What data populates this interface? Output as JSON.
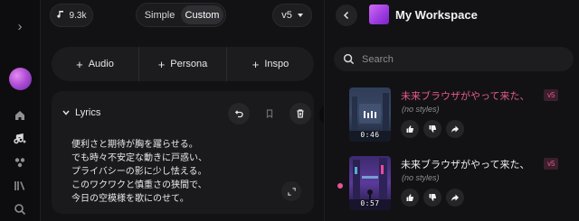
{
  "rail": {
    "icons": [
      "chevron-right-icon",
      "home-icon",
      "create-music-icon",
      "explore-icon",
      "library-icon",
      "search-icon"
    ]
  },
  "create": {
    "credits": "9.3k",
    "mode_options": [
      "Simple",
      "Custom"
    ],
    "mode_selected": "Custom",
    "version": "v5",
    "add_buttons": [
      {
        "label": "Audio"
      },
      {
        "label": "Persona"
      },
      {
        "label": "Inspo"
      }
    ],
    "lyrics": {
      "header": "Lyrics",
      "text": "便利さと期待が胸を躍らせる。\nでも時々不安定な動きに戸惑い、\nプライバシーの影に少し怯える。\nこのワクワクと慎重さの狭間で、\n今日の空模様を歌にのせて。"
    }
  },
  "workspace": {
    "title": "My Workspace",
    "search_placeholder": "Search",
    "songs": [
      {
        "title": "未来ブラウザがやって来た、",
        "title_color": "#e45a8f",
        "version": "v5",
        "style": "(no styles)",
        "duration": "0:46"
      },
      {
        "title": "未来ブラウザがやって来た、",
        "title_color": "#f0f0f2",
        "version": "v5",
        "style": "(no styles)",
        "duration": "0:57"
      }
    ]
  },
  "colors": {
    "accent_pink": "#e45a8f",
    "background": "#121214",
    "panel": "#1a1a1d"
  }
}
